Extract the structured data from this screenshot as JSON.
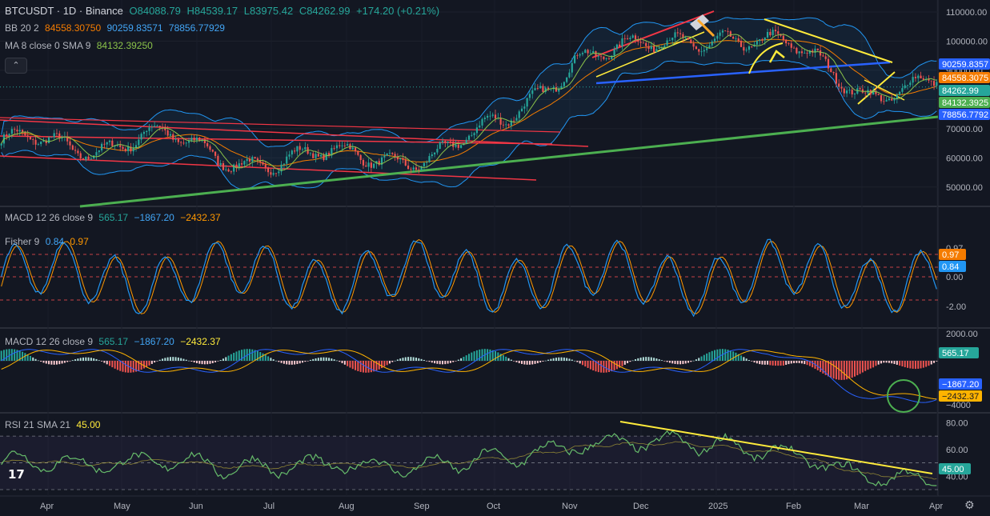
{
  "header": {
    "symbol": "BTCUSDT · 1D · Binance",
    "open_label": "O",
    "open": "84088.79",
    "high_label": "H",
    "high": "84539.17",
    "low_label": "L",
    "low": "83975.42",
    "close_label": "C",
    "close": "84262.99",
    "change": "+174.20 (+0.21%)"
  },
  "indicators": {
    "bb": {
      "label": "BB 20 2",
      "mid": "84558.30750",
      "upper": "90259.83571",
      "lower": "78856.77929"
    },
    "ma": {
      "label": "MA 8 close 0 SMA 9",
      "value": "84132.39250"
    },
    "macd1": {
      "label": "MACD 12 26 close 9",
      "hist": "565.17",
      "macd": "−1867.20",
      "signal": "−2432.37"
    },
    "fisher": {
      "label": "Fisher 9",
      "v1": "0.84",
      "v2": "0.97"
    },
    "macd2": {
      "label": "MACD 12 26 close 9",
      "hist": "565.17",
      "macd": "−1867.20",
      "signal": "−2432.37"
    },
    "rsi": {
      "label": "RSI 21 SMA 21",
      "value": "45.00"
    }
  },
  "colors": {
    "background": "#131722",
    "up": "#26a69a",
    "down": "#ef5350",
    "bb": "#2962ff",
    "orange": "#f57c00",
    "ma_green": "#4caf50",
    "yellow": "#ffeb3b",
    "red": "#f23645",
    "blue": "#2962ff"
  },
  "icons": [
    "collapse-chevron-icon",
    "tradingview-logo-icon",
    "settings-gear-icon",
    "hammer-icon"
  ],
  "ui": {
    "collapse_glyph": "⌃",
    "logo_text": "17",
    "settings_glyph": "⚙"
  },
  "chart_data": [
    {
      "type": "candlestick",
      "title": "BTCUSDT · 1D · Binance",
      "x_months": [
        "Apr",
        "May",
        "Jun",
        "Jul",
        "Aug",
        "Sep",
        "Oct",
        "Nov",
        "Dec",
        "2025",
        "Feb",
        "Mar",
        "Apr"
      ],
      "y_ticks": [
        "110000.00",
        "100000.00",
        "90000.00",
        "80000.00",
        "70000.00",
        "60000.00",
        "50000.00"
      ],
      "ylim": [
        45000,
        113000
      ],
      "approx_monthly_close": [
        66000,
        62000,
        70000,
        58000,
        62000,
        58000,
        63000,
        70000,
        97000,
        96000,
        104000,
        96000,
        84000,
        84263
      ],
      "price_labels": [
        {
          "value": "90259.8357",
          "color": "#2962ff"
        },
        {
          "value": "84558.3075",
          "color": "#f57c00"
        },
        {
          "value": "84262.99",
          "color": "#26a69a"
        },
        {
          "value": "84132.3925",
          "color": "#4caf50"
        },
        {
          "value": "78856.7792",
          "color": "#2962ff"
        }
      ]
    },
    {
      "type": "line",
      "title": "Fisher 9",
      "y_ticks": [
        "0.97",
        "0.00",
        "-2.00"
      ],
      "last_values": [
        "0.97",
        "0.84"
      ]
    },
    {
      "type": "bar",
      "title": "MACD 12 26 close 9",
      "y_ticks": [
        "2000.00",
        "0.00",
        "−4000"
      ],
      "last_values": [
        "565.17",
        "−1867.20",
        "−2432.37"
      ]
    },
    {
      "type": "line",
      "title": "RSI 21 SMA 21",
      "y_ticks": [
        "80.00",
        "60.00",
        "40.00"
      ],
      "ylim": [
        30,
        85
      ],
      "last_value": "45.00"
    }
  ]
}
